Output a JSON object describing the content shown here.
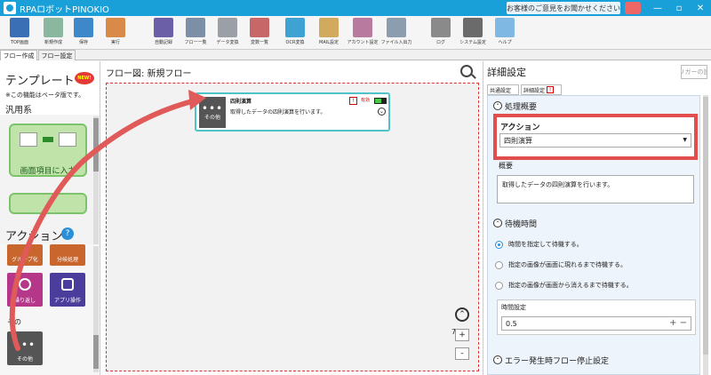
{
  "window": {
    "title": "RPAロボットPINOKIO",
    "feedback": "お客様のご意見をお聞かせください",
    "min": "—",
    "max": "▫",
    "close": "✕"
  },
  "toolbar": [
    {
      "label": "TOP画面",
      "color": "#3a6fb5"
    },
    {
      "label": "新規作成",
      "color": "#8ab7a0"
    },
    {
      "label": "保存",
      "color": "#3d88c9"
    },
    {
      "label": "実行",
      "color": "#d98a48"
    },
    {
      "label": "自動記録",
      "color": "#6b5fa8"
    },
    {
      "label": "フロー一覧",
      "color": "#7c8fa6"
    },
    {
      "label": "データ変換",
      "color": "#9aa0a6"
    },
    {
      "label": "変数一覧",
      "color": "#c76767"
    },
    {
      "label": "OCR変換",
      "color": "#3ea3d2"
    },
    {
      "label": "MAIL設定",
      "color": "#d1aa5e"
    },
    {
      "label": "アカウント設定",
      "color": "#b97aa0"
    },
    {
      "label": "ファイル入出力",
      "color": "#8d9db0"
    },
    {
      "label": "ログ",
      "color": "#8a8a8a"
    },
    {
      "label": "システム設定",
      "color": "#6b6b6b"
    },
    {
      "label": "ヘルプ",
      "color": "#7fb8e2"
    }
  ],
  "tabs": {
    "flow_create": "フロー作成",
    "flow_settings": "フロー設定"
  },
  "left": {
    "template_title": "テンプレート",
    "new_badge": "NEW!",
    "beta_note": "※この機能はベータ版です。",
    "category": "汎用系",
    "card_text": "画面項目に入力",
    "action_title": "アクション",
    "help": "?",
    "tiles": [
      {
        "label": "グループ化",
        "color": "#c9662e"
      },
      {
        "label": "分岐処理",
        "color": "#c9662e"
      },
      {
        "label": "繰り返し",
        "color": "#b4378a"
      },
      {
        "label": "アプリ操作",
        "color": "#4a3d9c"
      },
      {
        "label": "その他",
        "color": "#555555"
      }
    ],
    "section_other": "その"
  },
  "center": {
    "title": "フロー図: 新規フロー",
    "node": {
      "title": "四則演算",
      "desc": "取得したデータの四則演算を行います。",
      "icon_label": "その他",
      "warn": "!",
      "enabled": "有効"
    },
    "zoom_pct": "75%",
    "zoom_plus": "+",
    "zoom_minus": "-"
  },
  "right": {
    "title": "詳細設定",
    "trigger_btn": "トリガーの設定",
    "tab_common": "共通設定",
    "tab_detail": "詳細設定",
    "section_overview": "処理概要",
    "action_label": "アクション",
    "action_value": "四則演算",
    "overview_label": "概要",
    "overview_value": "取得したデータの四則演算を行います。",
    "section_wait": "待機時間",
    "radios": [
      {
        "label": "時間を指定して待機する。",
        "on": true
      },
      {
        "label": "指定の画像が画面に現れるまで待機する。",
        "on": false
      },
      {
        "label": "指定の画像が画面から消えるまで待機する。",
        "on": false
      }
    ],
    "time_label": "時間設定",
    "time_value": "0.5",
    "section_error": "エラー発生時フロー停止設定"
  }
}
